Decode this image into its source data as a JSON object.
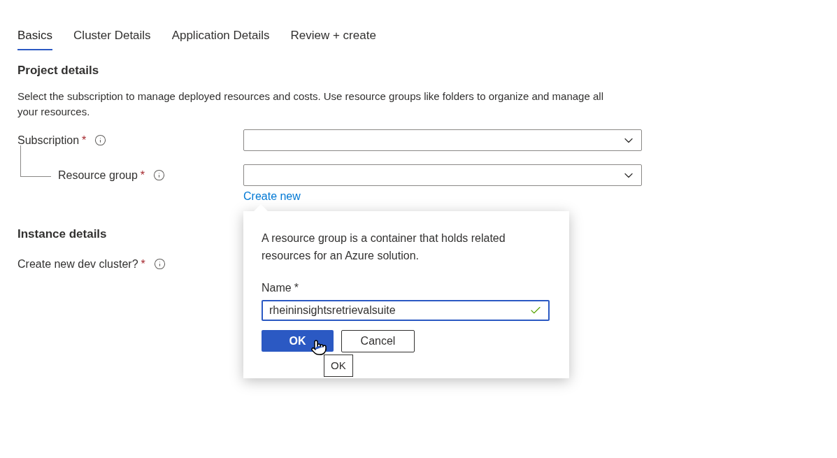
{
  "tabs": [
    {
      "label": "Basics",
      "selected": true
    },
    {
      "label": "Cluster Details",
      "selected": false
    },
    {
      "label": "Application Details",
      "selected": false
    },
    {
      "label": "Review + create",
      "selected": false
    }
  ],
  "project_details": {
    "heading": "Project details",
    "description": "Select the subscription to manage deployed resources and costs. Use resource groups like folders to organize and manage all your resources.",
    "subscription": {
      "label": "Subscription",
      "required_mark": "*"
    },
    "resource_group": {
      "label": "Resource group",
      "required_mark": "*",
      "create_new_link": "Create new"
    }
  },
  "instance_details": {
    "heading": "Instance details",
    "dev_cluster": {
      "label": "Create new dev cluster?",
      "required_mark": "*"
    }
  },
  "create_resource_group_popup": {
    "description": "A resource group is a container that holds related resources for an Azure solution.",
    "name_label": "Name",
    "required_mark": "*",
    "name_value": "rheininsightsretrievalsuite",
    "valid": true,
    "ok_button": "OK",
    "cancel_button": "Cancel",
    "tooltip": "OK"
  }
}
